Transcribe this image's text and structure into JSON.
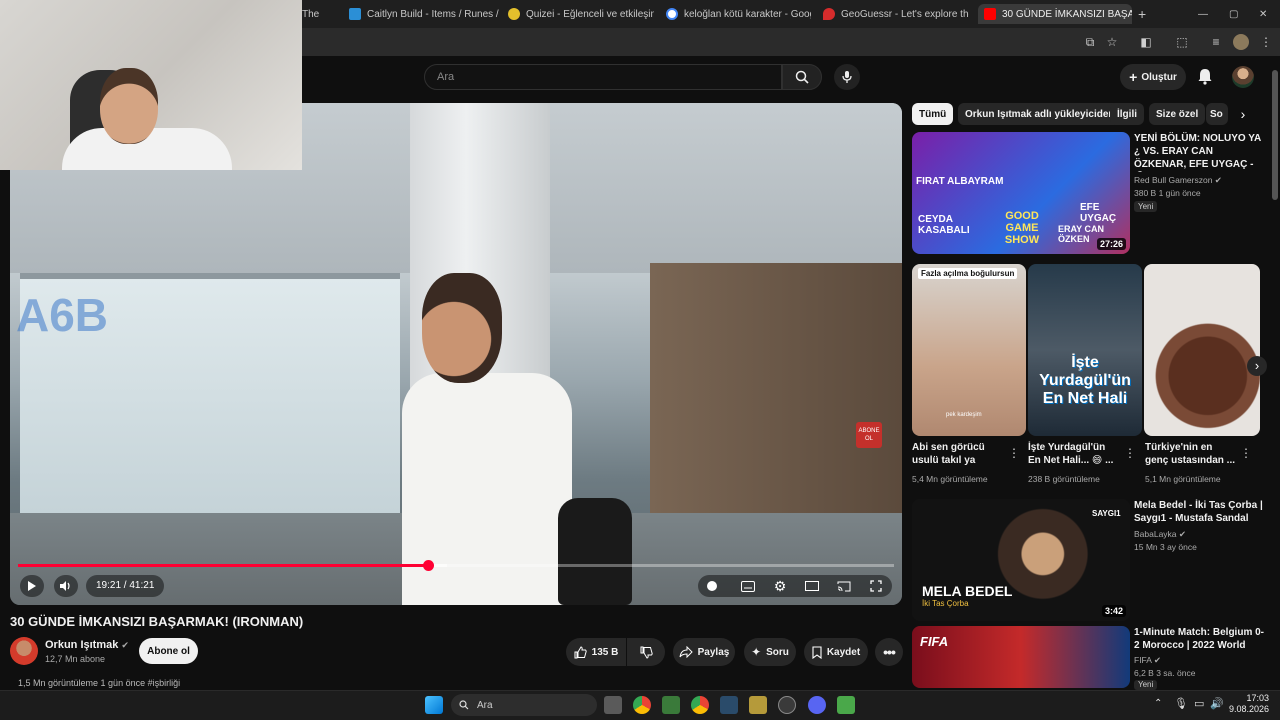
{
  "browser": {
    "tabs": [
      {
        "label": "The",
        "icon": "tab-favicon"
      },
      {
        "label": "Caitlyn Build - Items / Runes / I",
        "icon": "leaguetips-favicon"
      },
      {
        "label": "Quizei - Eğlenceli ve etkileşim",
        "icon": "quiz-favicon"
      },
      {
        "label": "keloğlan kötü karakter - Googl",
        "icon": "google-favicon"
      },
      {
        "label": "GeoGuessr - Let's explore the w",
        "icon": "geoguessr-favicon"
      },
      {
        "label": "30 GÜNDE İMKANSIZI BAŞARM",
        "icon": "youtube-favicon"
      }
    ],
    "new_tab": "+",
    "window_controls": [
      "—",
      "▢",
      "✕"
    ]
  },
  "youtube": {
    "search_placeholder": "Ara",
    "create_label": "Oluştur"
  },
  "player": {
    "time": "19:21 / 41:21",
    "progress": 0.468,
    "buffered": 0.49,
    "airport_sign": "A6B",
    "abone_badge": "ABONE OL"
  },
  "video": {
    "title": "30 GÜNDE İMKANSIZI BAŞARMAK! (IRONMAN)",
    "channel": "Orkun Işıtmak",
    "subscribers": "12,7 Mn abone",
    "subscribe_label": "Abone ol",
    "likes": "135 B",
    "share_label": "Paylaş",
    "ask_label": "Soru",
    "save_label": "Kaydet",
    "description_peek": "1,5 Mn görüntüleme  1 gün önce  #işbirliği"
  },
  "chips": [
    "Tümü",
    "Orkun Işıtmak adlı yükleyiciden",
    "İlgili",
    "Size özel",
    "So"
  ],
  "recommendations": [
    {
      "title": "YENİ BÖLÜM: NOLUYO YA ¿ VS. ERAY CAN ÖZKENAR, EFE UYGAÇ - 🎙 ...",
      "channel": "Red Bull Gamerszon",
      "meta": "380 B  1 gün önce",
      "badge": "Yeni",
      "duration": "27:26",
      "thumb_text": [
        "FIRAT ALBAYRAM",
        "CEYDA KASABALI",
        "GOOD GAME SHOW",
        "EFE UYGAÇ",
        "ERAY CAN ÖZKEN"
      ]
    },
    {
      "title": "Mela Bedel - İki Tas Çorba | Saygı1 - Mustafa Sandal",
      "channel": "BabaLayka",
      "meta": "15 Mn  3 ay önce",
      "duration": "3:42",
      "thumb_text": [
        "MELA BEDEL",
        "İki Tas Çorba",
        "SAYGI1"
      ]
    },
    {
      "title": "1-Minute Match: Belgium 0-2 Morocco | 2022 World Cup",
      "channel": "FIFA",
      "meta": "6,2 B  3 sa. önce",
      "badge": "Yeni",
      "thumb_text": [
        "FIFA"
      ]
    }
  ],
  "shorts": [
    {
      "title": "Abi sen görücü usulü takıl ya",
      "views": "5,4 Mn görüntüleme",
      "overlay": "Fazla açılma boğulursun",
      "caption": "pek kardeşim"
    },
    {
      "title": "İşte Yurdagül'ün En Net Hali... 😄 ...",
      "views": "238 B görüntüleme",
      "overlay": "İşte Yurdagül'ün En Net Hali"
    },
    {
      "title": "Türkiye'nin en genç ustasından ...",
      "views": "5,1 Mn görüntüleme"
    }
  ],
  "taskbar": {
    "search_placeholder": "Ara",
    "time": "17:03",
    "date": "9.08.2026"
  },
  "colors": {
    "accent": "#ff0033",
    "background": "#0f0f0f",
    "chip": "#272727"
  }
}
